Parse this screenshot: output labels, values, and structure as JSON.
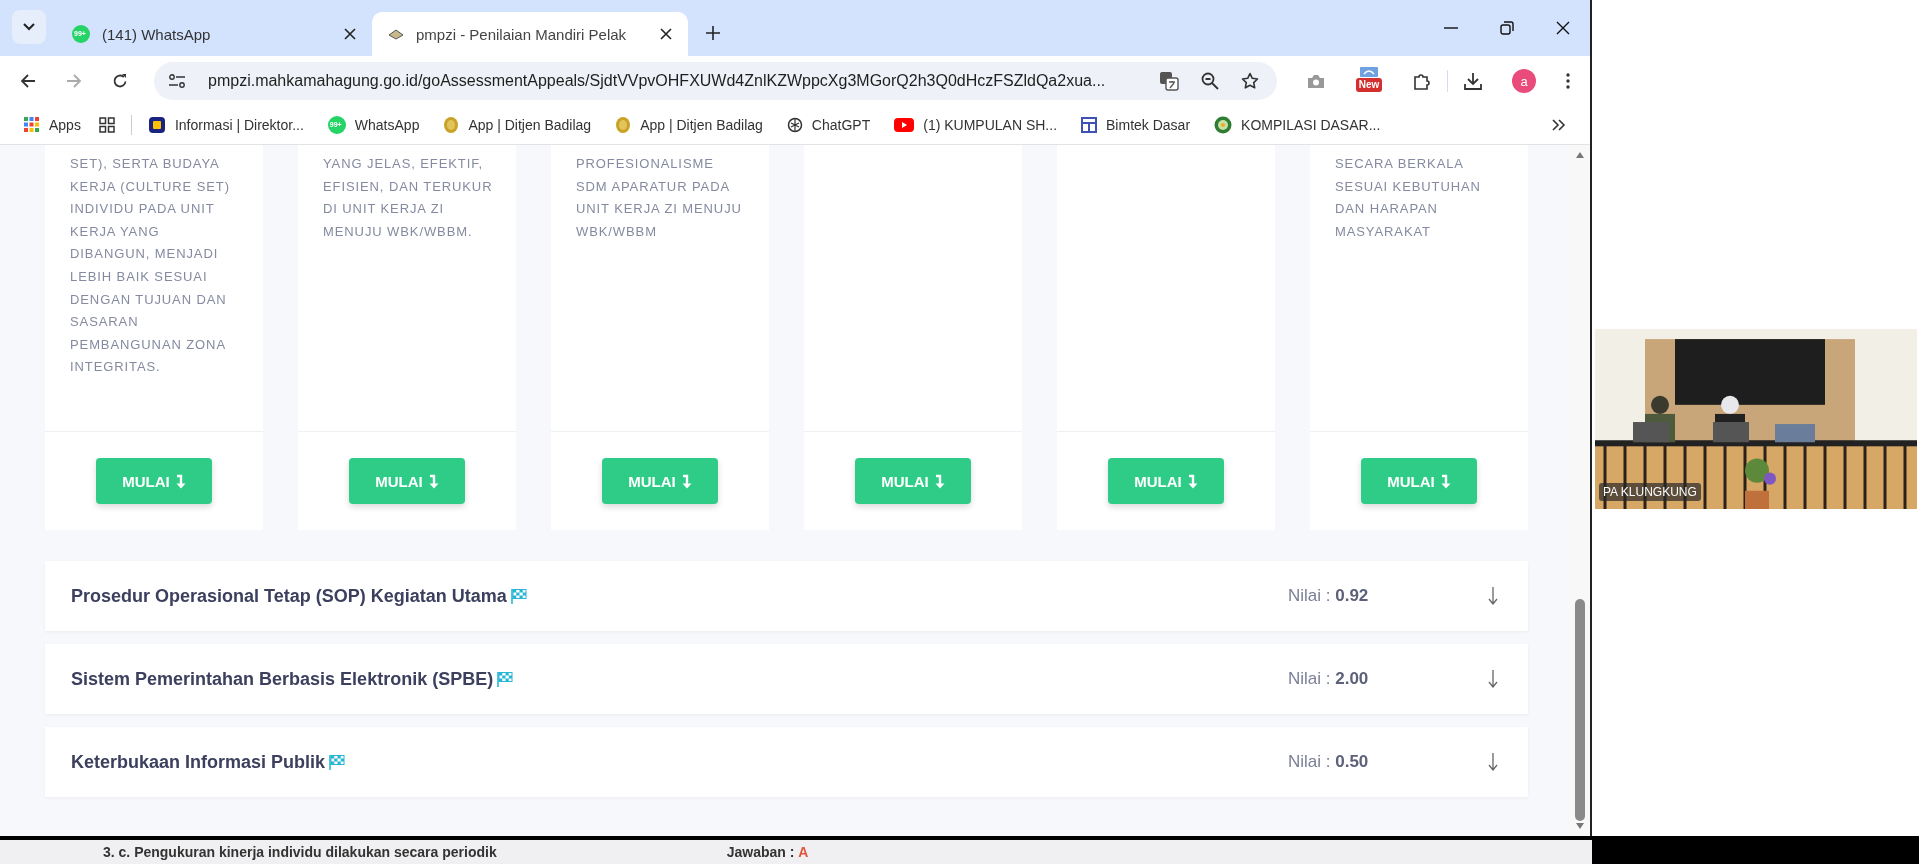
{
  "browser": {
    "tabs": [
      {
        "title": "(141) WhatsApp",
        "kind": "chat",
        "badge": "99+",
        "selected": false
      },
      {
        "title": "pmpzi - Penilaian Mandiri Pelak",
        "kind": "book",
        "selected": true
      }
    ],
    "url": "pmpzi.mahkamahagung.go.id/goAssessmentAppeals/SjdtVVpvOHFXUWd4ZnlKZWppcXg3MGorQ2h3Q0dHczFSZldQa2xua...",
    "extension_badge": "New",
    "avatar": "a",
    "bookmarks": [
      {
        "label": "Apps",
        "kind": "apps"
      },
      {
        "kind": "grid"
      },
      {
        "label": "Informasi | Direktor...",
        "kind": "info"
      },
      {
        "label": "WhatsApp",
        "kind": "chat",
        "badge": "99+"
      },
      {
        "label": "App | Ditjen Badilag",
        "kind": "coin"
      },
      {
        "label": "App | Ditjen Badilag",
        "kind": "coin"
      },
      {
        "label": "ChatGPT",
        "kind": "knot"
      },
      {
        "label": "(1) KUMPULAN SH...",
        "kind": "play"
      },
      {
        "label": "Bimtek Dasar",
        "kind": "layout"
      },
      {
        "label": "KOMPILASI DASAR...",
        "kind": "emblem"
      }
    ]
  },
  "cards": [
    {
      "description": "SET), SERTA BUDAYA KERJA (CULTURE SET) INDIVIDU PADA UNIT KERJA YANG DIBANGUN, MENJADI LEBIH BAIK SESUAI DENGAN TUJUAN DAN SASARAN PEMBANGUNAN ZONA INTEGRITAS.",
      "button": "MULAI"
    },
    {
      "description": "YANG JELAS, EFEKTIF, EFISIEN, DAN TERUKUR DI UNIT KERJA ZI MENUJU WBK/WBBM.",
      "button": "MULAI"
    },
    {
      "description": "PROFESIONALISME SDM APARATUR PADA UNIT KERJA ZI MENUJU WBK/WBBM",
      "button": "MULAI"
    },
    {
      "button": "MULAI"
    },
    {
      "button": "MULAI"
    },
    {
      "description": "SECARA BERKALA SESUAI KEBUTUHAN DAN HARAPAN MASYARAKAT",
      "button": "MULAI"
    }
  ],
  "sections": [
    {
      "title": "Prosedur Operasional Tetap (SOP) Kegiatan Utama",
      "score_label": "Nilai :",
      "score": "0.92"
    },
    {
      "title": "Sistem Pemerintahan Berbasis Elektronik (SPBE)",
      "score_label": "Nilai :",
      "score": "2.00"
    },
    {
      "title": "Keterbukaan Informasi Publik",
      "score_label": "Nilai :",
      "score": "0.50"
    }
  ],
  "meeting_tile": {
    "name": "PA KLUNGKUNG"
  },
  "background_window": {
    "question": "3. c. Pengukuran kinerja individu dilakukan secara periodik",
    "answer_label": "Jawaban :",
    "answer": "A"
  }
}
